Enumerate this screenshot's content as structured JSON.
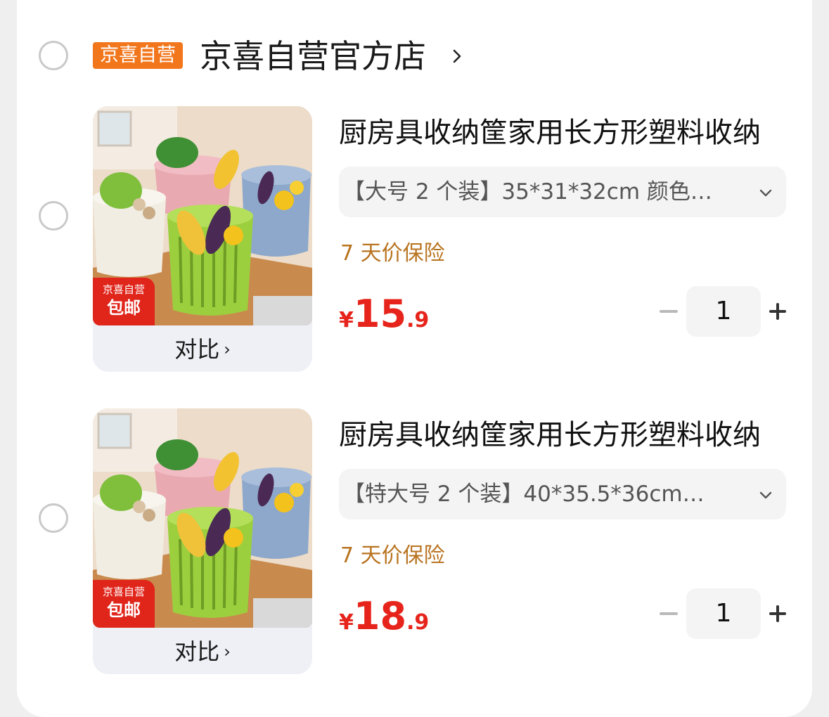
{
  "store": {
    "badge": "京喜自营",
    "name": "京喜自营官方店"
  },
  "products": [
    {
      "title": "厨房具收纳筐家用长方形塑料收纳",
      "spec": "【大号 2 个装】35*31*32cm 颜色…",
      "insurance": "7 天价保险",
      "currency": "¥",
      "price_int": "15",
      "price_dec": ".9",
      "quantity": "1",
      "compare_label": "对比",
      "promo_top": "京喜自营",
      "promo_bottom": "包邮"
    },
    {
      "title": "厨房具收纳筐家用长方形塑料收纳",
      "spec": "【特大号 2 个装】40*35.5*36cm…",
      "insurance": "7 天价保险",
      "currency": "¥",
      "price_int": "18",
      "price_dec": ".9",
      "quantity": "1",
      "compare_label": "对比",
      "promo_top": "京喜自营",
      "promo_bottom": "包邮"
    }
  ],
  "colors": {
    "accent_orange": "#f2761c",
    "price_red": "#e6241b",
    "insurance_brown": "#b8731f",
    "promo_red": "#e0251b"
  }
}
